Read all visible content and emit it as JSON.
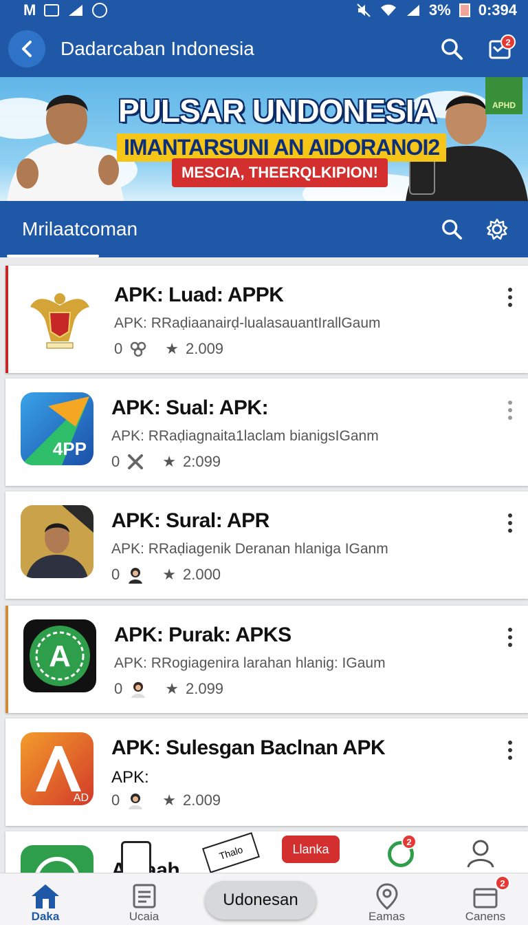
{
  "status_bar": {
    "left_text": "M",
    "battery": "3%",
    "time": "0:394"
  },
  "app_bar": {
    "title": "Dadarcaban Indonesia",
    "notification_count": "2"
  },
  "banner": {
    "headline": "PULSAR UNDONESIA",
    "subheadline": "IMANTARSUNI AN AIDORANOI2",
    "button_text": "MESCIA, THEERQLKIPION!",
    "corner_logo": "APHD"
  },
  "tab_bar": {
    "title": "Mrilaatcoman"
  },
  "apps": [
    {
      "name": "APK: Luad: APPK",
      "subtitle": "APK: RRaḍiaanairḍ-lualasauantIrallGaum",
      "count": "0",
      "rating": "2.009"
    },
    {
      "name": "APK: Sual: APK:",
      "subtitle": "APK: RRaḍiagnaita1laclam bianigsIGanm",
      "count": "0",
      "rating": "2:099"
    },
    {
      "name": "APK: Sural: APR",
      "subtitle": "APK: RRaḍiagenik Deranan hlaniga IGanm",
      "count": "0",
      "rating": "2.000"
    },
    {
      "name": "APK: Purak: APKS",
      "subtitle": "APK: RRogiagenira larahan hlanig: IGaum",
      "count": "0",
      "rating": "2.099"
    },
    {
      "name": "APK: Sulesgan Baclnan APK",
      "subtitle": "APK:",
      "count": "0",
      "rating": "2.009"
    },
    {
      "name": "A  Baah",
      "subtitle": "",
      "count": "",
      "rating": ""
    }
  ],
  "partial_row": {
    "overlay_tag": "Llanka",
    "sign_text": "Thalo",
    "notification_count": "2"
  },
  "bottom_nav": [
    {
      "label": "Daka",
      "icon": "home-icon",
      "active": true
    },
    {
      "label": "Ucaia",
      "icon": "document-icon"
    },
    {
      "label": "Udonesan",
      "icon": ""
    },
    {
      "label": "Eamas",
      "icon": "user-pin-icon"
    },
    {
      "label": "Canens",
      "icon": "wallet-icon",
      "badge": "2"
    }
  ],
  "colors": {
    "primary": "#1e58a6",
    "accent_red": "#e53935",
    "background": "#e9eaec"
  }
}
